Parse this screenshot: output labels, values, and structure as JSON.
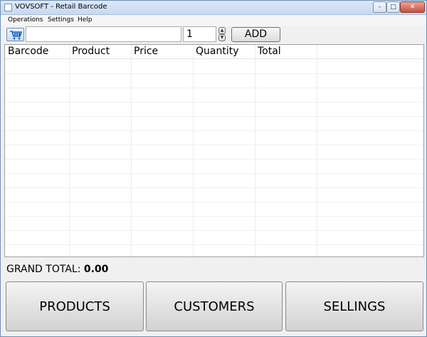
{
  "window": {
    "title": "VOVSOFT - Retail Barcode"
  },
  "title_buttons": {
    "minimize": "–",
    "maximize": "□",
    "close": "✕"
  },
  "menu": [
    "Operations",
    "Settings",
    "Help"
  ],
  "toolbar": {
    "cart_icon": "shopping-cart-icon",
    "barcode_value": "",
    "quantity_value": "1",
    "spin_up": "▲",
    "spin_down": "▼",
    "add_label": "ADD"
  },
  "table": {
    "columns": [
      "Barcode",
      "Product",
      "Price",
      "Quantity",
      "Total"
    ],
    "rows": []
  },
  "footer": {
    "grand_total_label": "GRAND TOTAL:",
    "grand_total_value": "0.00"
  },
  "buttons": {
    "products": "PRODUCTS",
    "customers": "CUSTOMERS",
    "sellings": "SELLINGS"
  }
}
